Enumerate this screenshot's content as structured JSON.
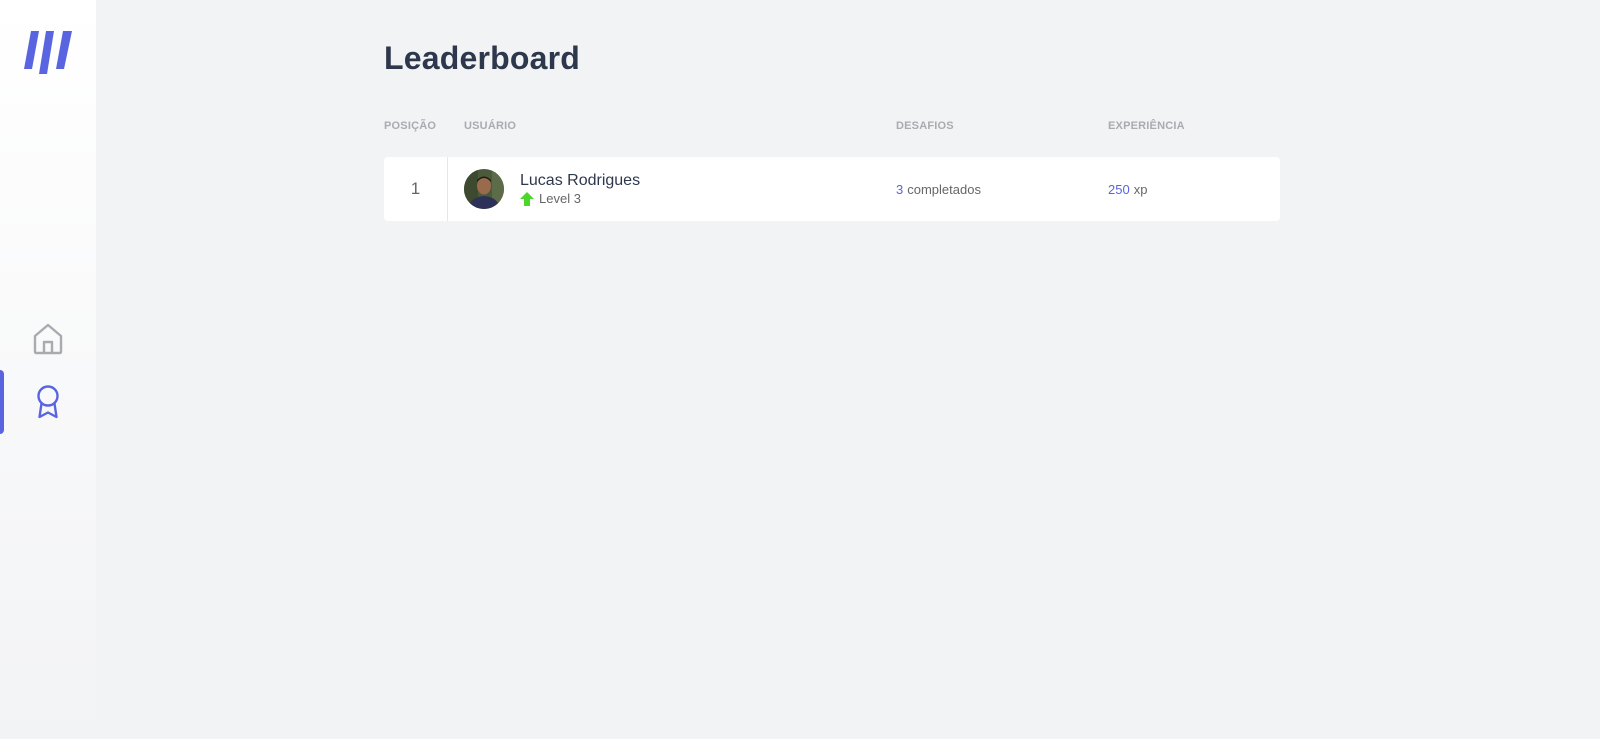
{
  "colors": {
    "accent": "#5965e0",
    "level_up": "#4cd62b",
    "text_primary": "#2e384d",
    "text_secondary": "#666666",
    "header_text": "#a9abb0"
  },
  "sidebar": {
    "logo_icon": "moveit-logo-icon",
    "items": [
      {
        "name": "home",
        "icon": "home-icon",
        "active": false
      },
      {
        "name": "leaderboard",
        "icon": "award-icon",
        "active": true
      }
    ]
  },
  "page": {
    "title": "Leaderboard"
  },
  "table": {
    "headers": {
      "position": "POSIÇÃO",
      "user": "USUÁRIO",
      "challenges": "DESAFIOS",
      "experience": "EXPERIÊNCIA"
    },
    "rows": [
      {
        "position": "1",
        "name": "Lucas Rodrigues",
        "level_label": "Level 3",
        "challenges_count": "3",
        "challenges_suffix": "completados",
        "xp_value": "250",
        "xp_suffix": "xp"
      }
    ]
  }
}
